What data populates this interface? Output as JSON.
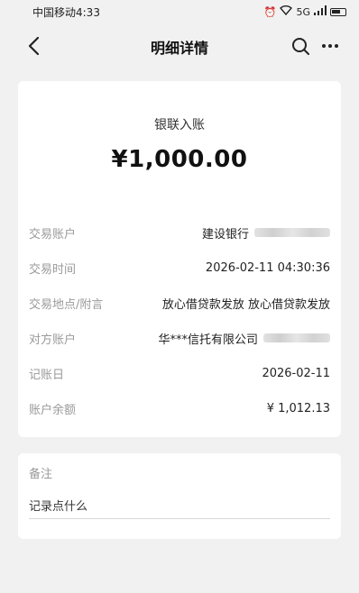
{
  "status_bar": {
    "carrier_time": "中国移动4:33",
    "network": "5G"
  },
  "header": {
    "title": "明细详情"
  },
  "detail": {
    "headline": "银联入账",
    "amount": "¥1,000.00",
    "rows": [
      {
        "label": "交易账户",
        "value": "建设银行"
      },
      {
        "label": "交易时间",
        "value": "2026-02-11 04:30:36"
      },
      {
        "label": "交易地点/附言",
        "value": "放心借贷款发放 放心借贷款发放"
      },
      {
        "label": "对方账户",
        "value": "华***信托有限公司"
      },
      {
        "label": "记账日",
        "value": "2026-02-11"
      },
      {
        "label": "账户余额",
        "value": "¥ 1,012.13"
      }
    ]
  },
  "note": {
    "label": "备注",
    "placeholder": "记录点什么"
  }
}
